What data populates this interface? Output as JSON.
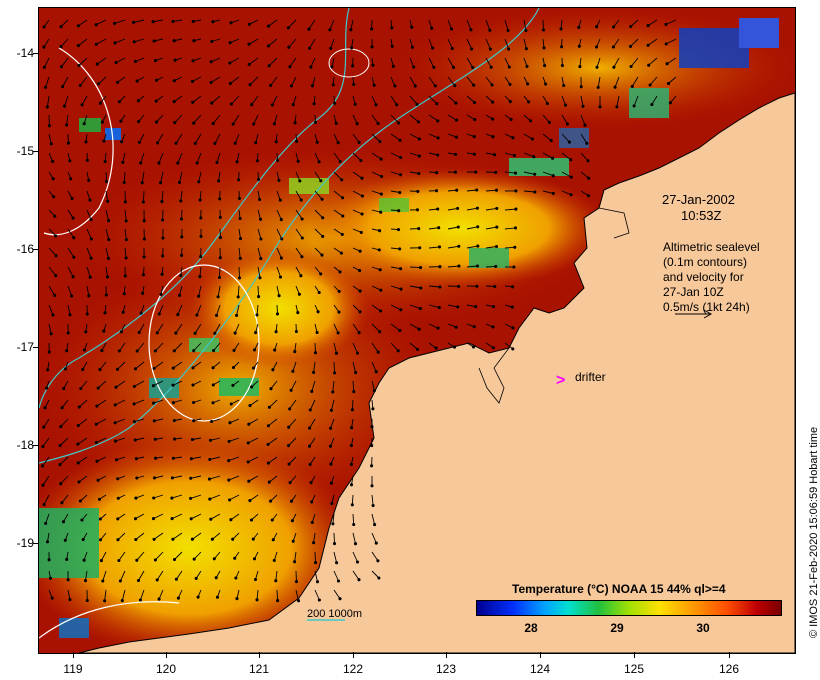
{
  "map": {
    "y_ticks": [
      "-14",
      "-15",
      "-16",
      "-17",
      "-18",
      "-19"
    ],
    "x_ticks": [
      "119",
      "120",
      "121",
      "122",
      "123",
      "124",
      "125",
      "126"
    ],
    "date": "27-Jan-2002",
    "time": "10:53Z",
    "altimetry_lines": [
      "Altimetric sealevel",
      "(0.1m contours)",
      "and velocity for",
      "27-Jan 10Z",
      "0.5m/s (1kt 24h)"
    ],
    "drifter_label": "drifter",
    "scalebar_label": "200  1000m",
    "credit": "© IMOS 21-Feb-2020 15:06:59 Hobart time"
  },
  "colorbar": {
    "title": "Temperature (°C) NOAA 15 44% ql>=4",
    "ticks": [
      "28",
      "29",
      "30"
    ]
  },
  "colors": {
    "land": "#f7c89a",
    "warm_sea": "#a81200",
    "mid_sea": "#e07000",
    "cool_sea": "#f0c800",
    "contour_sealevel": "#ffffff",
    "bathymetry": "#40c8c8",
    "drifter_marker": "#ff00ff"
  }
}
